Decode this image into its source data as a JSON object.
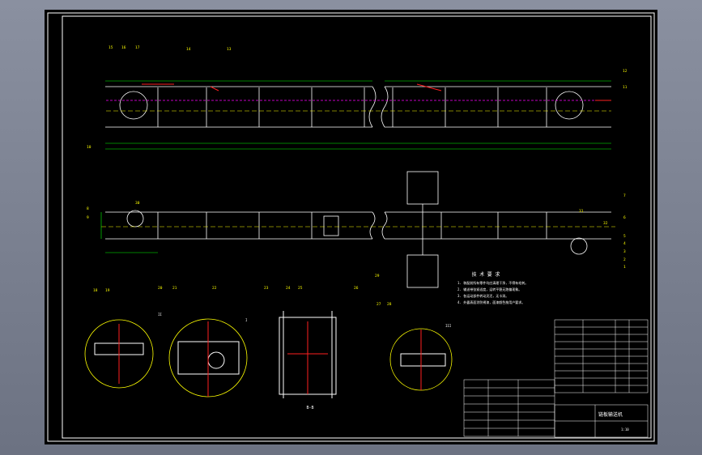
{
  "window": {
    "bg": "#7a8190"
  },
  "drawing": {
    "sheet_bg": "#000000",
    "colors": {
      "white": "#ffffff",
      "green": "#00ff00",
      "red": "#ff2020",
      "yellow": "#ffff00",
      "cyan": "#00ffff",
      "magenta": "#ff00ff"
    },
    "section_label": "B-B",
    "requirements_title": "技 术 要 求",
    "requirements": [
      "1. 装配前所有零件均应清理干净，不得有毛刺。",
      "2. 输送带张紧适度，运转平稳无跑偏现象。",
      "3. 各运动部件转动灵活，无卡滞。",
      "4. 外露表面涂防锈漆，面漆颜色按用户要求。"
    ],
    "title_block": {
      "title": "链板输送机",
      "scale": "1:10"
    },
    "callouts": [
      "1",
      "2",
      "3",
      "4",
      "5",
      "6",
      "7",
      "8",
      "9",
      "10",
      "11",
      "12",
      "13",
      "14",
      "15",
      "16",
      "17",
      "18",
      "19",
      "20",
      "21",
      "22",
      "23",
      "24",
      "25",
      "26",
      "27",
      "28",
      "29",
      "30",
      "31",
      "32"
    ],
    "detail_labels": [
      "II",
      "I",
      "III"
    ]
  }
}
